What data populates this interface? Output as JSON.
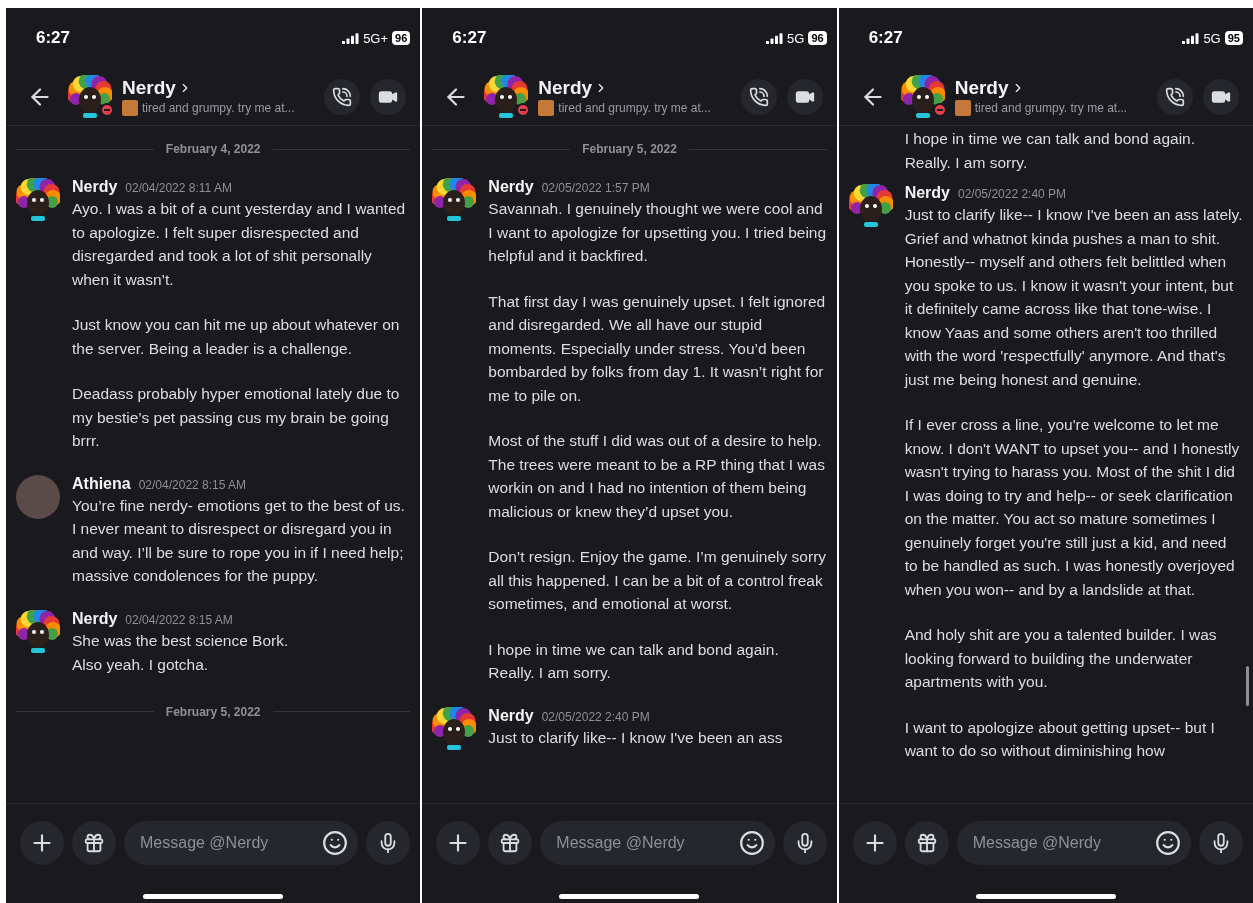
{
  "phones": [
    {
      "status": {
        "time": "6:27",
        "network": "5G+",
        "battery": "96"
      },
      "header": {
        "name": "Nerdy",
        "status_text": "tired and grumpy. try me at..."
      },
      "items": [
        {
          "kind": "divider",
          "label": "February 4, 2022"
        },
        {
          "kind": "message",
          "author": "Nerdy",
          "timestamp": "02/04/2022 8:11 AM",
          "avatar": {
            "kind": "rainbow"
          },
          "paragraphs": [
            "Ayo. I was a bit of a cunt yesterday and I wanted to apologize. I felt super disrespected and disregarded and took a lot of shit personally when it wasn’t.",
            "Just know you can hit me up about whatever on the server. Being a leader is a challenge.",
            "Deadass probably hyper emotional lately due to my bestie’s pet passing cus my brain be going brrr."
          ]
        },
        {
          "kind": "message",
          "author": "Athiena",
          "timestamp": "02/04/2022 8:15 AM",
          "avatar": {
            "kind": "photo"
          },
          "paragraphs": [
            "You’re fine nerdy- emotions get to the best of us. I never meant to disrespect or disregard you in and way. I’ll be sure to rope you in if I need help; massive condolences for the puppy."
          ]
        },
        {
          "kind": "message",
          "author": "Nerdy",
          "timestamp": "02/04/2022 8:15 AM",
          "avatar": {
            "kind": "rainbow"
          },
          "lines": [
            "She was the best science Bork.",
            "Also yeah. I gotcha."
          ]
        },
        {
          "kind": "divider",
          "label": "February 5, 2022"
        }
      ],
      "composer": {
        "placeholder": "Message @Nerdy"
      }
    },
    {
      "status": {
        "time": "6:27",
        "network": "5G",
        "battery": "96"
      },
      "header": {
        "name": "Nerdy",
        "status_text": "tired and grumpy. try me at..."
      },
      "items": [
        {
          "kind": "divider",
          "label": "February 5, 2022"
        },
        {
          "kind": "message",
          "author": "Nerdy",
          "timestamp": "02/05/2022 1:57 PM",
          "avatar": {
            "kind": "rainbow"
          },
          "paragraphs": [
            "Savannah. I genuinely thought we were cool and I want to apologize for upsetting you. I tried being helpful and it backfired.",
            "That first day I was genuinely upset. I felt ignored and disregarded. We all have our stupid moments. Especially under stress. You’d been bombarded by folks from day 1. It wasn’t right for me to pile on.",
            "Most of the stuff I did was out of a desire to help. The trees were meant to be a RP thing that I was workin on and I had no intention of them being malicious or knew they’d upset you.",
            "Don’t resign. Enjoy the game. I’m genuinely sorry all this happened. I can be a bit of a control freak sometimes, and emotional at worst.",
            "I hope in time we can talk and bond again. Really. I am sorry."
          ]
        },
        {
          "kind": "message",
          "author": "Nerdy",
          "timestamp": "02/05/2022 2:40 PM",
          "avatar": {
            "kind": "rainbow"
          },
          "paragraphs": [
            "Just to clarify like-- I know I've been an ass"
          ]
        }
      ],
      "composer": {
        "placeholder": "Message @Nerdy"
      }
    },
    {
      "status": {
        "time": "6:27",
        "network": "5G",
        "battery": "95"
      },
      "header": {
        "name": "Nerdy",
        "status_text": "tired and grumpy. try me at..."
      },
      "items": [
        {
          "kind": "continuation",
          "paragraphs": [
            "I hope in time we can talk and bond again. Really. I am sorry."
          ]
        },
        {
          "kind": "message",
          "author": "Nerdy",
          "timestamp": "02/05/2022 2:40 PM",
          "avatar": {
            "kind": "rainbow"
          },
          "paragraphs": [
            "Just to clarify like-- I know I've been an ass lately. Grief and whatnot kinda pushes a man to shit. Honestly-- myself and others felt belittled when you spoke to us. I know it wasn't your intent, but it definitely came across like that tone-wise. I know Yaas and some others aren't too thrilled with the word 'respectfully' anymore. And that's just me being honest and genuine.",
            "If I ever cross a line, you're welcome to let me know. I don't WANT to upset you-- and I honestly wasn't trying to harass you. Most of the shit I did I was doing to try and help-- or seek clarification on the matter. You act so mature sometimes I genuinely forget you're still just a kid, and need to be handled as such. I was honestly overjoyed when you won-- and by a landslide at that.",
            "And holy shit are you a talented builder. I was looking forward to building the underwater apartments with you.",
            "I want to apologize about getting upset-- but I want to do so without diminishing how"
          ]
        }
      ],
      "composer": {
        "placeholder": "Message @Nerdy"
      }
    }
  ]
}
